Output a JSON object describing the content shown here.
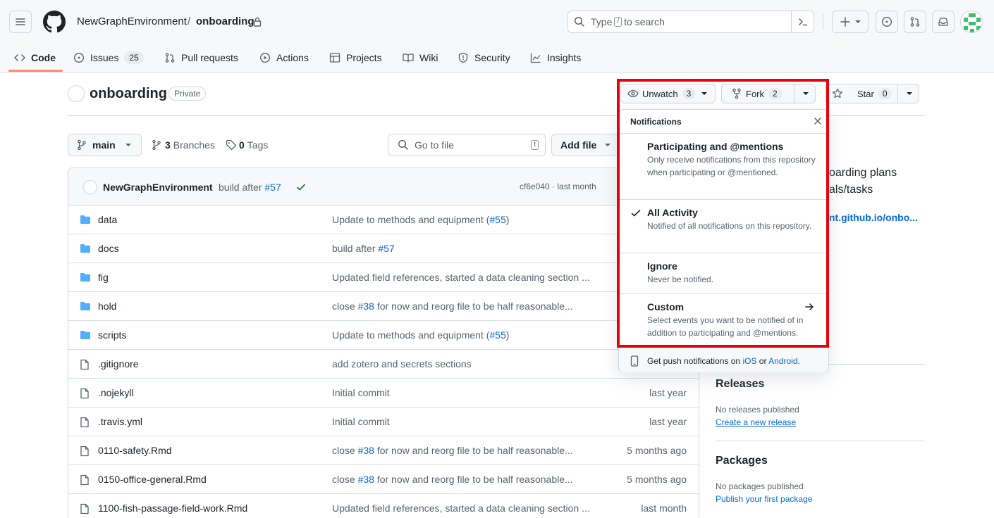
{
  "header": {
    "owner": "NewGraphEnvironment",
    "separator": "/",
    "repo": "onboarding",
    "search_prefix": "Type",
    "search_key": "/",
    "search_suffix": "to search"
  },
  "tabs": [
    {
      "label": "Code"
    },
    {
      "label": "Issues",
      "count": "25"
    },
    {
      "label": "Pull requests"
    },
    {
      "label": "Actions"
    },
    {
      "label": "Projects"
    },
    {
      "label": "Wiki"
    },
    {
      "label": "Security"
    },
    {
      "label": "Insights"
    }
  ],
  "repo": {
    "name": "onboarding",
    "visibility": "Private",
    "unwatch_label": "Unwatch",
    "watch_count": "3",
    "fork_label": "Fork",
    "fork_count": "2",
    "star_label": "Star",
    "star_count": "0"
  },
  "toolbar": {
    "branch": "main",
    "branches_count": "3",
    "branches_label": "Branches",
    "tags_count": "0",
    "tags_label": "Tags",
    "goto_placeholder": "Go to file",
    "goto_key": "t",
    "add_file": "Add file"
  },
  "commit": {
    "author": "NewGraphEnvironment",
    "message": "build after",
    "ref": "#57",
    "hash": "cf6e040",
    "dot": "·",
    "when": "last month"
  },
  "files": [
    {
      "name": "data",
      "type": "folder",
      "msg": "Update to methods and equipment (",
      "ref": "#55",
      "msg_end": ")",
      "when": ""
    },
    {
      "name": "docs",
      "type": "folder",
      "msg": "build after ",
      "ref": "#57",
      "msg_end": "",
      "when": ""
    },
    {
      "name": "fig",
      "type": "folder",
      "msg": "Updated field references, started a data cleaning section ...",
      "ref": "",
      "msg_end": "",
      "when": ""
    },
    {
      "name": "hold",
      "type": "folder",
      "msg": "close ",
      "ref": "#38",
      "msg_end": " for now and reorg file to be half reasonable...",
      "when": ""
    },
    {
      "name": "scripts",
      "type": "folder",
      "msg": "Update to methods and equipment (",
      "ref": "#55",
      "msg_end": ")",
      "when": ""
    },
    {
      "name": ".gitignore",
      "type": "file",
      "msg": "add zotero and secrets sections",
      "ref": "",
      "msg_end": "",
      "when": ""
    },
    {
      "name": ".nojekyll",
      "type": "file",
      "msg": "Initial commit",
      "ref": "",
      "msg_end": "",
      "when": "last year"
    },
    {
      "name": ".travis.yml",
      "type": "file",
      "msg": "Initial commit",
      "ref": "",
      "msg_end": "",
      "when": "last year"
    },
    {
      "name": "0110-safety.Rmd",
      "type": "file",
      "msg": "close ",
      "ref": "#38",
      "msg_end": " for now and reorg file to be half reasonable...",
      "when": "5 months ago"
    },
    {
      "name": "0150-office-general.Rmd",
      "type": "file",
      "msg": "close ",
      "ref": "#38",
      "msg_end": " for now and reorg file to be half reasonable...",
      "when": "5 months ago"
    },
    {
      "name": "1100-fish-passage-field-work.Rmd",
      "type": "file",
      "msg": "Updated field references, started a data cleaning section ...",
      "ref": "",
      "msg_end": "",
      "when": "last month"
    }
  ],
  "sidebar": {
    "about_line1": "oarding plans",
    "about_line2": "als/tasks",
    "about_link": "nt.github.io/onbo...",
    "releases_title": "Releases",
    "releases_text": "No releases published",
    "releases_link": "Create a new release",
    "packages_title": "Packages",
    "packages_text": "No packages published",
    "packages_link": "Publish your first package"
  },
  "notifications": {
    "title": "Notifications",
    "items": [
      {
        "title": "Participating and @mentions",
        "desc": "Only receive notifications from this repository when participating or @mentioned.",
        "checked": false
      },
      {
        "title": "All Activity",
        "desc": "Notified of all notifications on this repository.",
        "checked": true
      },
      {
        "title": "Ignore",
        "desc": "Never be notified.",
        "checked": false
      },
      {
        "title": "Custom",
        "desc": "Select events you want to be notified of in addition to participating and @mentions.",
        "checked": false
      }
    ],
    "footer_prefix": "Get push notifications on",
    "footer_ios": "iOS",
    "footer_or": "or",
    "footer_android": "Android",
    "footer_end": "."
  },
  "colors": {
    "accent": "#0969da",
    "highlight": "#e8000b",
    "tab_underline": "#fd8c73",
    "success": "#1a7f37"
  }
}
